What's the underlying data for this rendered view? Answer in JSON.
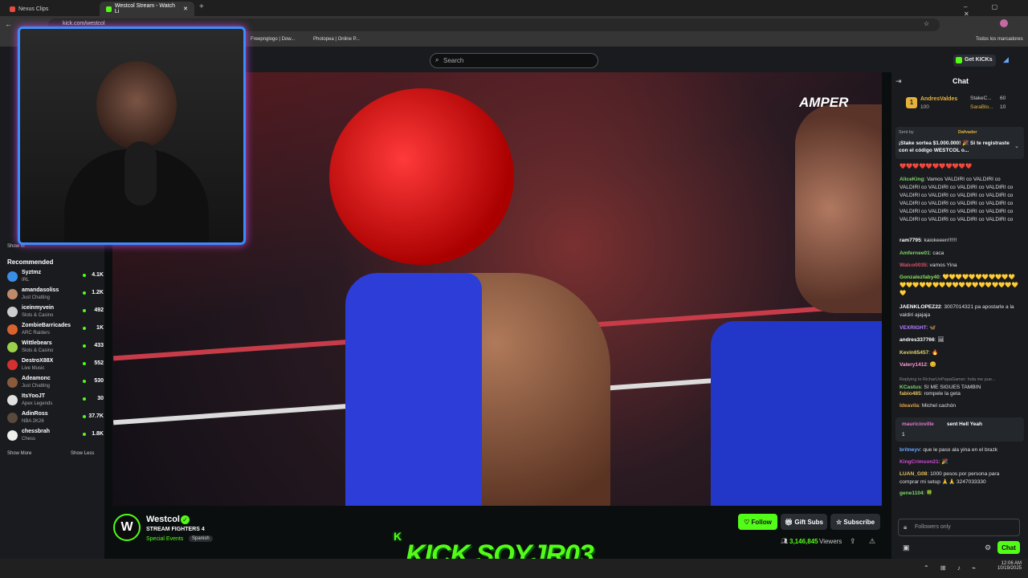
{
  "browser": {
    "tab1": "Nexus Clips",
    "tab2": "Westcol Stream - Watch Li",
    "url": "kick.com/westcol",
    "bookmarks": [
      "Freepnglogo | Dow...",
      "Photopea | Online P..."
    ],
    "all_bookmarks": "Todos los marcadores"
  },
  "topnav": {
    "search_placeholder": "Search",
    "get_kicks": "Get KICKs"
  },
  "sidebar": {
    "show_more_top": "Show m",
    "recommended_title": "Recommended",
    "show_more": "Show More",
    "show_less": "Show Less",
    "items": [
      {
        "name": "Syztmz",
        "category": "IRL",
        "viewers": "4.1K",
        "color": "#3a8ee6"
      },
      {
        "name": "amandasoliss",
        "category": "Just Chatting",
        "viewers": "1.2K",
        "color": "#c08a6a"
      },
      {
        "name": "iceinmyvein",
        "category": "Slots & Casino",
        "viewers": "492",
        "color": "#cccccc"
      },
      {
        "name": "ZombieBarricades",
        "category": "ARC Raiders",
        "viewers": "1K",
        "color": "#d9632e"
      },
      {
        "name": "Wittlebears",
        "category": "Slots & Casino",
        "viewers": "433",
        "color": "#9bd14a"
      },
      {
        "name": "DestroX88X",
        "category": "Live Music",
        "viewers": "552",
        "color": "#d43030"
      },
      {
        "name": "Adeamonc",
        "category": "Just Chatting",
        "viewers": "530",
        "color": "#8a5a3a"
      },
      {
        "name": "ItsYooJT",
        "category": "Apex Legends",
        "viewers": "30",
        "color": "#e0e0e0"
      },
      {
        "name": "AdinRoss",
        "category": "NBA 2K26",
        "viewers": "37.7K",
        "color": "#5a4a3a"
      },
      {
        "name": "chessbrah",
        "category": "Chess",
        "viewers": "1.8K",
        "color": "#eeeeee"
      }
    ]
  },
  "video": {
    "watermark": "AMPER"
  },
  "channel": {
    "name": "Westcol",
    "title": "STREAM FIGHTERS 4",
    "category": "Special Events",
    "language": "Spanish",
    "viewers": "3,146,845",
    "viewers_label": "Viewers",
    "follow": "Follow",
    "gift": "Gift Subs",
    "subscribe": "Subscribe",
    "avatar_text": "W"
  },
  "overlay": {
    "text": "KICK SOYJR03",
    "k": "K"
  },
  "chat": {
    "title": "Chat",
    "leaderboard": {
      "rank": "1",
      "user": "AndresValdes",
      "points": "100",
      "second": "StakeC...",
      "second_pts": "60",
      "third": "SaraBlo...",
      "third_pts": "10"
    },
    "pinned": {
      "sent_by": "Sent by",
      "pinner": "Dafvader",
      "text": "¡Stake sortea $1.000.000! 🎉 Si te registraste con el código WESTCOL o..."
    },
    "messages": [
      {
        "user": "",
        "text": "❤️❤️❤️❤️❤️❤️❤️❤️❤️❤️❤️",
        "color": "#ffffff"
      },
      {
        "user": "AliceKing",
        "text": "Vamos VALDIRI co VALDIRI co VALDIRI co VALDIRI co VALDIRI co VALDIRI co VALDIRI co VALDIRI co VALDIRI co VALDIRI co VALDIRI co VALDIRI co VALDIRI co VALDIRI co VALDIRI co VALDIRI co VALDIRI co VALDIRI co VALDIRI co VALDIRI co VALDIRI co VALDIRI co",
        "color": "#7fd66a"
      },
      {
        "user": "ram7795",
        "text": "kaiokeeen!!!!!!",
        "color": "#ffffff"
      },
      {
        "user": "Amfernee01",
        "text": "caca",
        "color": "#7fd66a"
      },
      {
        "user": "Walco0035",
        "text": "vamos Yina",
        "color": "#e0506a"
      },
      {
        "user": "Gonzalezfaby40",
        "text": "💛💛💛💛💛💛💛💛💛💛💛💛💛💛💛💛💛💛💛💛💛💛💛💛💛💛💛💛💛💛",
        "color": "#8ee05a"
      },
      {
        "user": "JAENKLOPEZ22",
        "text": "3007014321 pa apostarle a la valdiri ajajaja",
        "color": "#ffffff"
      },
      {
        "user": "VEXRIGHT",
        "text": "🦋",
        "color": "#b57cff"
      },
      {
        "user": "andres337766",
        "text": "🖼",
        "color": "#ffffff"
      },
      {
        "user": "Kevin65457",
        "text": "🔥",
        "color": "#e6d36a"
      },
      {
        "user": "Valery1412",
        "text": "😊",
        "color": "#ff9ad2"
      },
      {
        "user": "KCastus",
        "reply": "Replying to RicharUnPapaGamer: hola me pue...",
        "text": "SI ME SIGUES TAMBIN",
        "color": "#7fd66a"
      },
      {
        "user": "fabio485",
        "text": "rompele la geta",
        "color": "#e6c35a"
      },
      {
        "user": "Ideavila",
        "text": "Michel cachón",
        "color": "#e6a23c"
      }
    ],
    "gift": {
      "user": "mauricioville",
      "text": "sent Hell Yeah",
      "count": "1"
    },
    "messages2": [
      {
        "user": "britneyv",
        "text": "que le paso ala yina en el brazk",
        "color": "#6aa8ff"
      },
      {
        "user": "KingCrimson21",
        "text": "🎉",
        "color": "#d04bd0"
      },
      {
        "user": "LUAN_G08",
        "text": "1000 pesos por persona para comprar mi setup 🙏🙏 3247033330",
        "color": "#e6c35a"
      },
      {
        "user": "gene1104",
        "text": "🍀",
        "color": "#7fd66a"
      }
    ],
    "input_placeholder": "Followers only",
    "send": "Chat"
  },
  "taskbar": {
    "time": "12:06 AM",
    "date": "10/19/2025"
  }
}
